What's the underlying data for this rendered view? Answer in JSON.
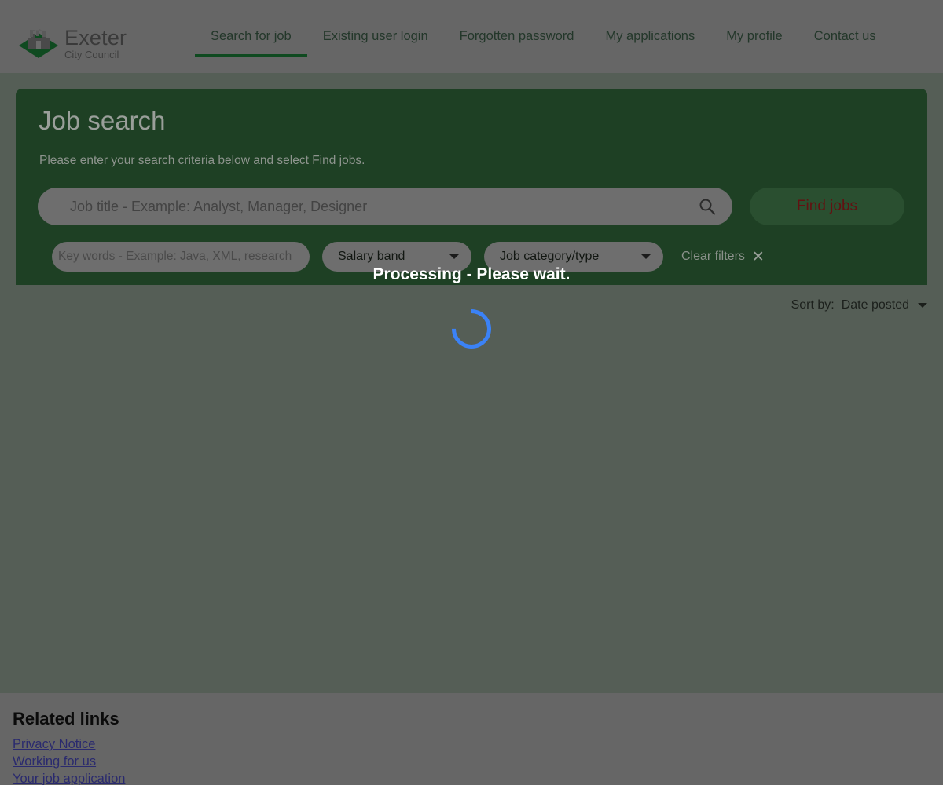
{
  "header": {
    "logo": {
      "icon": "exeter-castle-diamond-logo",
      "title": "Exeter",
      "subtitle": "City Council"
    },
    "nav": [
      {
        "label": "Search for job",
        "active": true
      },
      {
        "label": "Existing user login",
        "active": false
      },
      {
        "label": "Forgotten password",
        "active": false
      },
      {
        "label": "My applications",
        "active": false
      },
      {
        "label": "My profile",
        "active": false
      },
      {
        "label": "Contact us",
        "active": false
      }
    ]
  },
  "search_panel": {
    "title": "Job search",
    "subtitle": "Please enter your search criteria below and select Find jobs.",
    "job_title_input": {
      "value": "",
      "placeholder": "Job title - Example:  Analyst, Manager, Designer",
      "icon": "search-icon"
    },
    "find_jobs_button": "Find jobs",
    "keywords_input": {
      "value": "",
      "placeholder": "Key words - Example: Java, XML, research"
    },
    "salary_band_dropdown": {
      "label": "Salary band",
      "icon": "chevron-down-icon"
    },
    "job_category_dropdown": {
      "label": "Job category/type",
      "icon": "chevron-down-icon"
    },
    "clear_filters": {
      "label": "Clear filters",
      "icon": "close-x-icon"
    }
  },
  "overlay": {
    "processing_text": "Processing - Please wait.",
    "spinner": "loading-spinner-icon"
  },
  "results": {
    "sort_by_label": "Sort by:",
    "sort_by_value": "Date posted",
    "sort_icon": "chevron-down-icon"
  },
  "footer": {
    "title": "Related links",
    "links": [
      "Privacy Notice",
      "Working for us",
      "Your job application"
    ]
  },
  "colors": {
    "header_bg": "#666666",
    "page_bg": "#555e56",
    "panel_green": "#1e4024",
    "accent_green": "#0f4a20",
    "find_jobs_text": "#621111",
    "spinner_blue": "#3b82f6",
    "link_blue": "#2a2a6e"
  }
}
